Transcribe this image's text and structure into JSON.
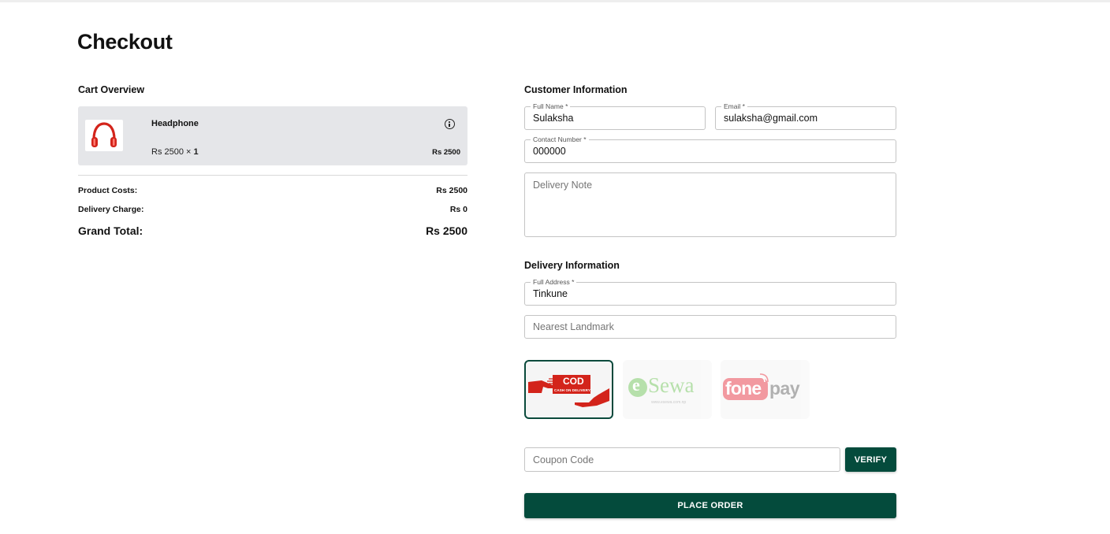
{
  "page": {
    "title": "Checkout"
  },
  "cart": {
    "section_title": "Cart Overview",
    "items": [
      {
        "icon": "headphone-icon",
        "name": "Headphone",
        "unit_price": "Rs 2500",
        "times": " × ",
        "quantity": "1",
        "line_total": "Rs 2500"
      }
    ],
    "summary": {
      "product_costs_label": "Product Costs:",
      "product_costs_value": "Rs 2500",
      "delivery_charge_label": "Delivery Charge:",
      "delivery_charge_value": "Rs 0",
      "grand_total_label": "Grand Total:",
      "grand_total_value": "Rs 2500"
    }
  },
  "customer": {
    "section_title": "Customer Information",
    "full_name": {
      "label": "Full Name *",
      "value": "Sulaksha"
    },
    "email": {
      "label": "Email *",
      "value": "sulaksha@gmail.com"
    },
    "contact": {
      "label": "Contact Number *",
      "value": "000000"
    },
    "delivery_note": {
      "placeholder": "Delivery Note",
      "value": ""
    }
  },
  "delivery": {
    "section_title": "Delivery Information",
    "full_address": {
      "label": "Full Address *",
      "value": "Tinkune"
    },
    "landmark": {
      "placeholder": "Nearest Landmark",
      "value": ""
    }
  },
  "payment": {
    "selected": "cod",
    "options": [
      {
        "id": "cod",
        "logo_text": "COD",
        "logo_subtext": "CASH ON DELIVERY"
      },
      {
        "id": "esewa",
        "logo_text": "Sewa",
        "logo_prefix": "e",
        "logo_subtext": "www.esewa.com.np"
      },
      {
        "id": "fonepay",
        "logo_text": "fone",
        "logo_suffix": "pay"
      }
    ]
  },
  "coupon": {
    "placeholder": "Coupon Code",
    "verify_label": "VERIFY"
  },
  "place_order_label": "PLACE ORDER",
  "colors": {
    "primary": "#044b3c",
    "card_bg": "#e5e6e9",
    "cod_red": "#d3241b",
    "esewa_green": "#60bb46",
    "fonepay_red": "#e4202f"
  }
}
